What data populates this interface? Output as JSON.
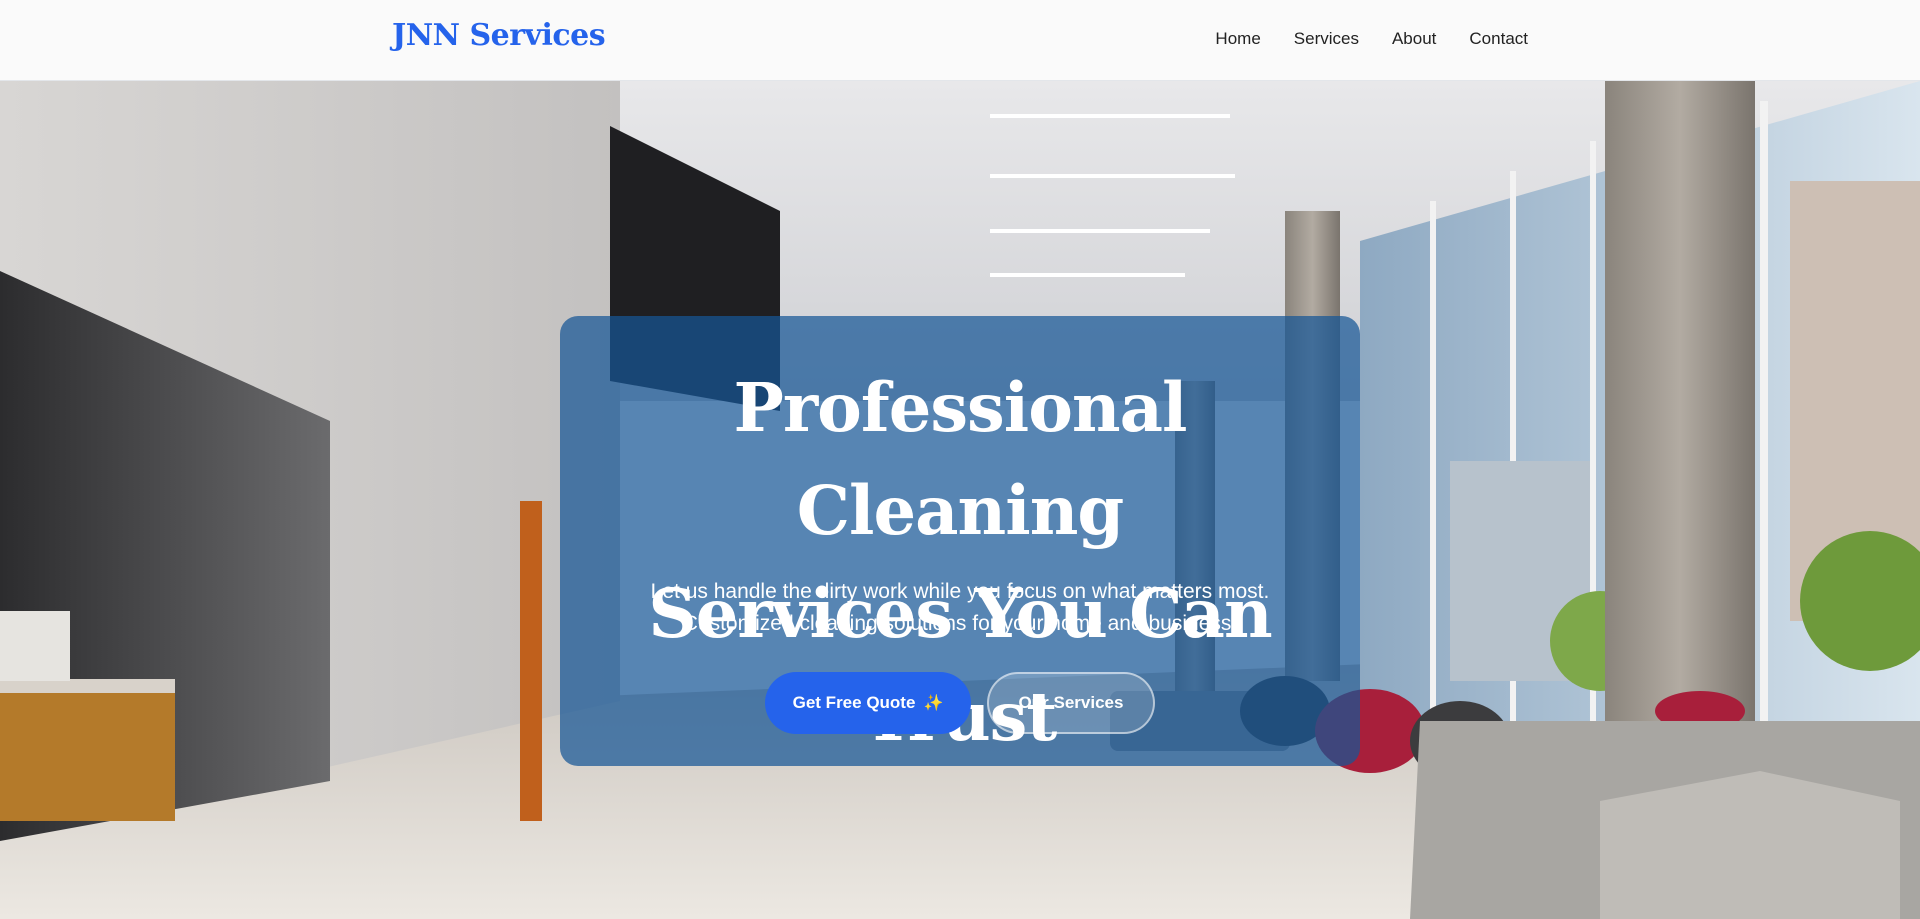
{
  "header": {
    "logo": "JNN Services",
    "nav": [
      {
        "label": "Home"
      },
      {
        "label": "Services"
      },
      {
        "label": "About"
      },
      {
        "label": "Contact"
      }
    ]
  },
  "hero": {
    "title_line1": "Professional Cleaning",
    "title_line2": "Services You Can Trust",
    "subtitle_line1": "Let us handle the dirty work while you focus on what matters most.",
    "subtitle_line2": "Customized cleaning solutions for your home and business.",
    "primary_button": "Get Free Quote",
    "primary_button_icon": "✨",
    "secondary_button": "Our Services"
  },
  "colors": {
    "brand": "#2563eb",
    "overlay": "#1a5a96"
  }
}
